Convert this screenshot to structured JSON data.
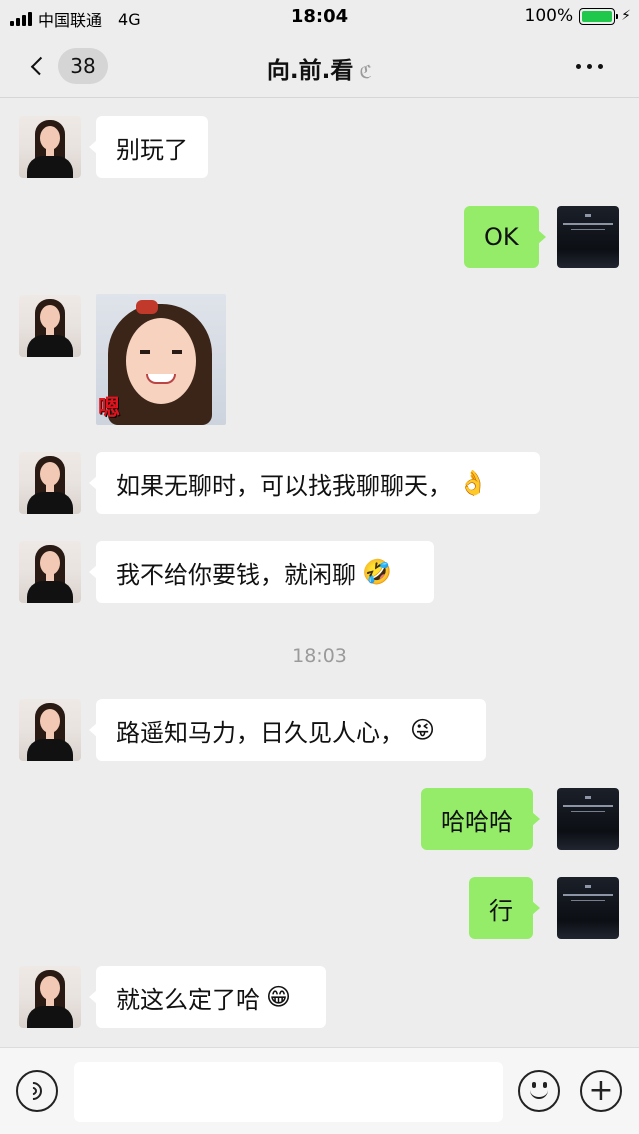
{
  "status_bar": {
    "carrier": "中国联通",
    "network": "4G",
    "time": "18:04",
    "battery": "100%",
    "battery_level": 1.0,
    "battery_color": "#1fc84a"
  },
  "nav": {
    "unread_count": "38",
    "title": "向.前.看",
    "mute_icon": "ear-muted-icon",
    "more_icon": "ellipsis-icon"
  },
  "messages": [
    {
      "side": "left",
      "type": "text",
      "text": "别玩了"
    },
    {
      "side": "right",
      "type": "text",
      "text": "OK"
    },
    {
      "side": "left",
      "type": "sticker",
      "sticker_text": "嗯"
    },
    {
      "side": "left",
      "type": "text",
      "text": "如果无聊时，可以找我聊聊天，",
      "emoji": "👌"
    },
    {
      "side": "left",
      "type": "text",
      "text": "我不给你要钱，就闲聊",
      "emoji": "🤣"
    },
    {
      "side": "left",
      "type": "text",
      "text": "路遥知马力，日久见人心，",
      "emoji": "😜"
    },
    {
      "side": "right",
      "type": "text",
      "text": "哈哈哈"
    },
    {
      "side": "right",
      "type": "text",
      "text": "行"
    },
    {
      "side": "left",
      "type": "text",
      "text": "就这么定了哈",
      "emoji": "😁"
    }
  ],
  "timestamp": "18:03",
  "input_bar": {
    "voice_icon": "voice-icon",
    "emoji_icon": "emoji-face-icon",
    "plus_icon": "plus-icon",
    "plus_glyph": "+",
    "input_value": ""
  },
  "colors": {
    "background": "#ededed",
    "bubble_self": "#95ec69",
    "bubble_other": "#ffffff"
  }
}
